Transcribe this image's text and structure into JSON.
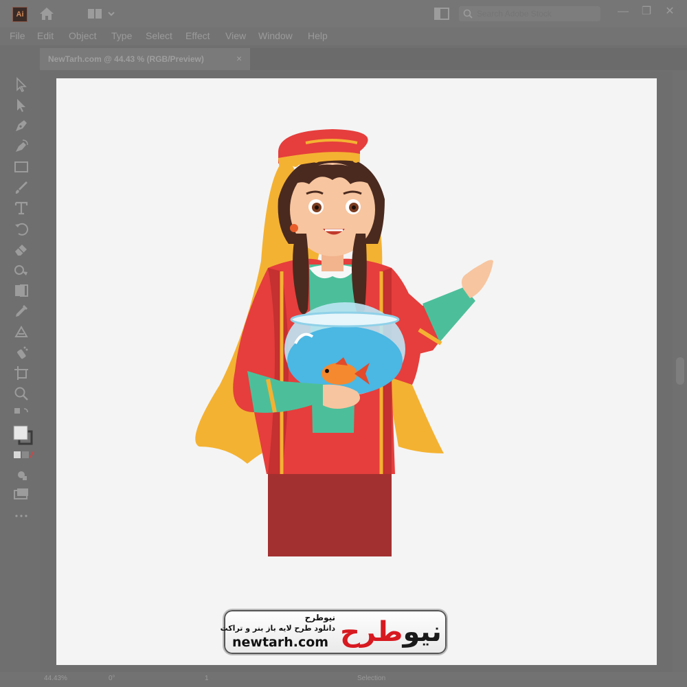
{
  "titlebar": {
    "search_placeholder": "Search Adobe Stock"
  },
  "menu": [
    "File",
    "Edit",
    "Object",
    "Type",
    "Select",
    "Effect",
    "View",
    "Window",
    "Help"
  ],
  "document_tab": {
    "label": "NewTarh.com @ 44.43 % (RGB/Preview)",
    "close": "×"
  },
  "status": {
    "zoom": "44.43%",
    "rotation": "0°",
    "artboard": "1",
    "mode": "Selection"
  },
  "tools": [
    "selection-tool",
    "direct-selection-tool",
    "pen-tool",
    "curvature-tool",
    "rectangle-tool",
    "paintbrush-tool",
    "type-tool",
    "rotate-tool",
    "eraser-tool",
    "width-tool",
    "shape-builder-tool",
    "eyedropper-tool",
    "blend-tool",
    "symbol-sprayer-tool",
    "artboard-tool",
    "zoom-tool"
  ],
  "watermark": {
    "brand_small": "نیوطرح",
    "tagline": "دانلود طرح لایه باز بنر و تراکت",
    "url": "newtarh.com",
    "logo_part1": "نیو",
    "logo_part2": "طرح"
  },
  "colors": {
    "accent": "#d71920",
    "artboard": "#f4f4f4"
  }
}
